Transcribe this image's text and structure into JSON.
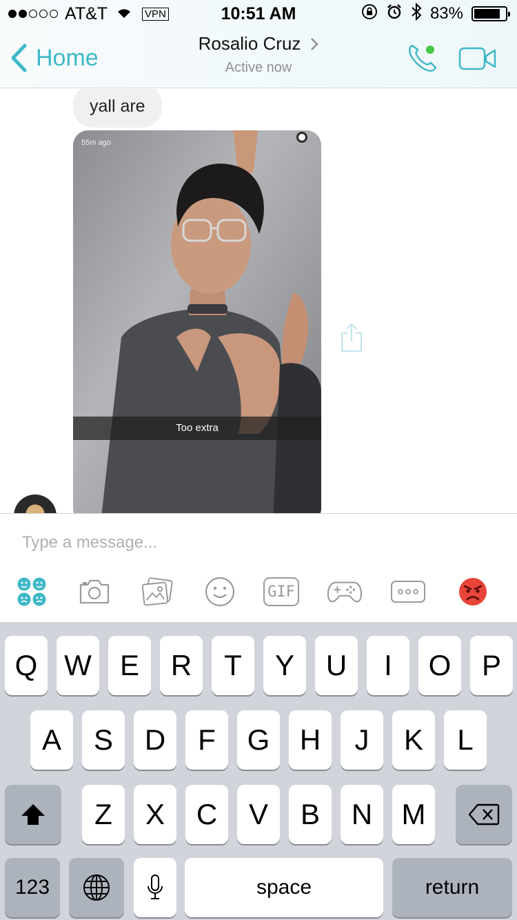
{
  "status_bar": {
    "carrier": "AT&T",
    "vpn": "VPN",
    "time": "10:51 AM",
    "battery": "83%",
    "battery_level": 0.83,
    "signal_bars": 2,
    "icons": [
      "wifi-icon",
      "orientation-lock-icon",
      "alarm-icon",
      "bluetooth-icon",
      "battery-icon"
    ]
  },
  "nav": {
    "back_label": "Home",
    "contact_name": "Rosalio Cruz",
    "presence": "Active now",
    "accent": "#3fb8c7",
    "presence_dot": "#44c944",
    "actions": [
      "phone-icon",
      "video-camera-icon"
    ]
  },
  "messages": [
    {
      "type": "text",
      "text": "yall are"
    },
    {
      "type": "image",
      "overlay_time": "55m ago",
      "caption": "Too extra"
    }
  ],
  "composer": {
    "placeholder": "Type a message...",
    "value": "",
    "tools": [
      "stickers-icon",
      "camera-icon",
      "photo-gallery-icon",
      "emoji-icon",
      "gif-icon",
      "games-icon",
      "more-icon",
      "angry-face-emoji-icon"
    ],
    "gif_label": "GIF"
  },
  "keyboard": {
    "row1": [
      "Q",
      "W",
      "E",
      "R",
      "T",
      "Y",
      "U",
      "I",
      "O",
      "P"
    ],
    "row2": [
      "A",
      "S",
      "D",
      "F",
      "G",
      "H",
      "J",
      "K",
      "L"
    ],
    "row3": [
      "Z",
      "X",
      "C",
      "V",
      "B",
      "N",
      "M"
    ],
    "numbers_label": "123",
    "space_label": "space",
    "return_label": "return"
  }
}
